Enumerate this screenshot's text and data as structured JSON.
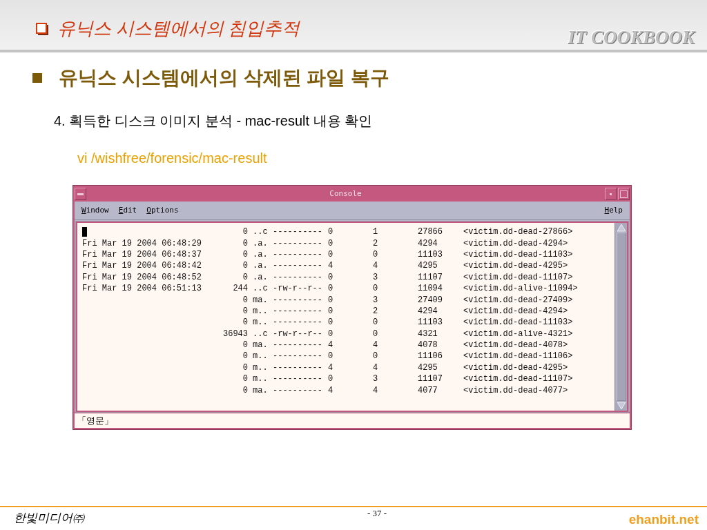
{
  "header": {
    "section_title": "유닉스 시스템에서의 침입추적",
    "logo_text": "IT COOKBOOK"
  },
  "heading": "유닉스 시스템에서의 삭제된 파일 복구",
  "step": "4. 획득한 디스크 이미지 분석 - mac-result 내용 확인",
  "command": "vi /wishfree/forensic/mac-result",
  "console": {
    "title": "Console",
    "menu": [
      "Window",
      "Edit",
      "Options"
    ],
    "help": "Help",
    "cursor": true,
    "rows": [
      {
        "column_2": "0",
        "column_3": "..c",
        "column_4": "----------",
        "column_5": "0",
        "column_6": "1",
        "column_7": "27866",
        "column_8": "<victim.dd-dead-27866>"
      },
      {
        "column_1": "Fri Mar 19 2004 06:48:29",
        "column_2": "0",
        "column_3": ".a.",
        "column_4": "----------",
        "column_5": "0",
        "column_6": "2",
        "column_7": "4294",
        "column_8": "<victim.dd-dead-4294>"
      },
      {
        "column_1": "Fri Mar 19 2004 06:48:37",
        "column_2": "0",
        "column_3": ".a.",
        "column_4": "----------",
        "column_5": "0",
        "column_6": "0",
        "column_7": "11103",
        "column_8": "<victim.dd-dead-11103>"
      },
      {
        "column_1": "Fri Mar 19 2004 06:48:42",
        "column_2": "0",
        "column_3": ".a.",
        "column_4": "----------",
        "column_5": "4",
        "column_6": "4",
        "column_7": "4295",
        "column_8": "<victim.dd-dead-4295>"
      },
      {
        "column_1": "Fri Mar 19 2004 06:48:52",
        "column_2": "0",
        "column_3": ".a.",
        "column_4": "----------",
        "column_5": "0",
        "column_6": "3",
        "column_7": "11107",
        "column_8": "<victim.dd-dead-11107>"
      },
      {
        "column_1": "Fri Mar 19 2004 06:51:13",
        "column_2": "244",
        "column_3": "..c",
        "column_4": "-rw-r--r--",
        "column_5": "0",
        "column_6": "0",
        "column_7": "11094",
        "column_8": "<victim.dd-alive-11094>"
      },
      {
        "column_2": "0",
        "column_3": "ma.",
        "column_4": "----------",
        "column_5": "0",
        "column_6": "3",
        "column_7": "27409",
        "column_8": "<victim.dd-dead-27409>"
      },
      {
        "column_2": "0",
        "column_3": "m..",
        "column_4": "----------",
        "column_5": "0",
        "column_6": "2",
        "column_7": "4294",
        "column_8": "<victim.dd-dead-4294>"
      },
      {
        "column_2": "0",
        "column_3": "m..",
        "column_4": "----------",
        "column_5": "0",
        "column_6": "0",
        "column_7": "11103",
        "column_8": "<victim.dd-dead-11103>"
      },
      {
        "column_2": "36943",
        "column_3": "..c",
        "column_4": "-rw-r--r--",
        "column_5": "0",
        "column_6": "0",
        "column_7": "4321",
        "column_8": "<victim.dd-alive-4321>"
      },
      {
        "column_2": "0",
        "column_3": "ma.",
        "column_4": "----------",
        "column_5": "4",
        "column_6": "4",
        "column_7": "4078",
        "column_8": "<victim.dd-dead-4078>"
      },
      {
        "column_2": "0",
        "column_3": "m..",
        "column_4": "----------",
        "column_5": "0",
        "column_6": "0",
        "column_7": "11106",
        "column_8": "<victim.dd-dead-11106>"
      },
      {
        "column_2": "0",
        "column_3": "m..",
        "column_4": "----------",
        "column_5": "4",
        "column_6": "4",
        "column_7": "4295",
        "column_8": "<victim.dd-dead-4295>"
      },
      {
        "column_2": "0",
        "column_3": "m..",
        "column_4": "----------",
        "column_5": "0",
        "column_6": "3",
        "column_7": "11107",
        "column_8": "<victim.dd-dead-11107>"
      },
      {
        "column_2": "0",
        "column_3": "ma.",
        "column_4": "----------",
        "column_5": "4",
        "column_6": "4",
        "column_7": "4077",
        "column_8": "<victim.dd-dead-4077>"
      }
    ],
    "status": "「영문」"
  },
  "footer": {
    "publisher": "한빛미디어㈜",
    "page": "- 37 -",
    "site": "ehanbit.net"
  }
}
